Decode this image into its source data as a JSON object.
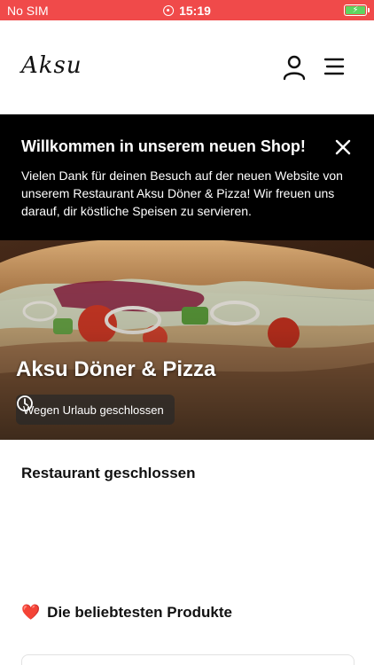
{
  "status_bar": {
    "carrier": "No SIM",
    "time": "15:19",
    "battery_color": "#5fd35f",
    "background": "#f04a4a"
  },
  "header": {
    "logo": "Aksu",
    "icons": [
      "user-icon",
      "hamburger-menu-icon"
    ]
  },
  "welcome_banner": {
    "title": "Willkommen in unserem neuen Shop!",
    "text": "Vielen Dank für deinen Besuch auf der neuen Website von unserem Restaurant Aksu Döner & Pizza! Wir freuen uns darauf, dir köstliche Speisen zu servieren.",
    "close_icon": "close-icon"
  },
  "hero": {
    "restaurant_name": "Aksu Döner & Pizza",
    "status_text": "Wegen Urlaub geschlossen",
    "status_icon": "clock-icon"
  },
  "sections": {
    "closed_heading": "Restaurant geschlossen",
    "popular_emoji": "❤️",
    "popular_heading": "Die beliebtesten Produkte"
  }
}
